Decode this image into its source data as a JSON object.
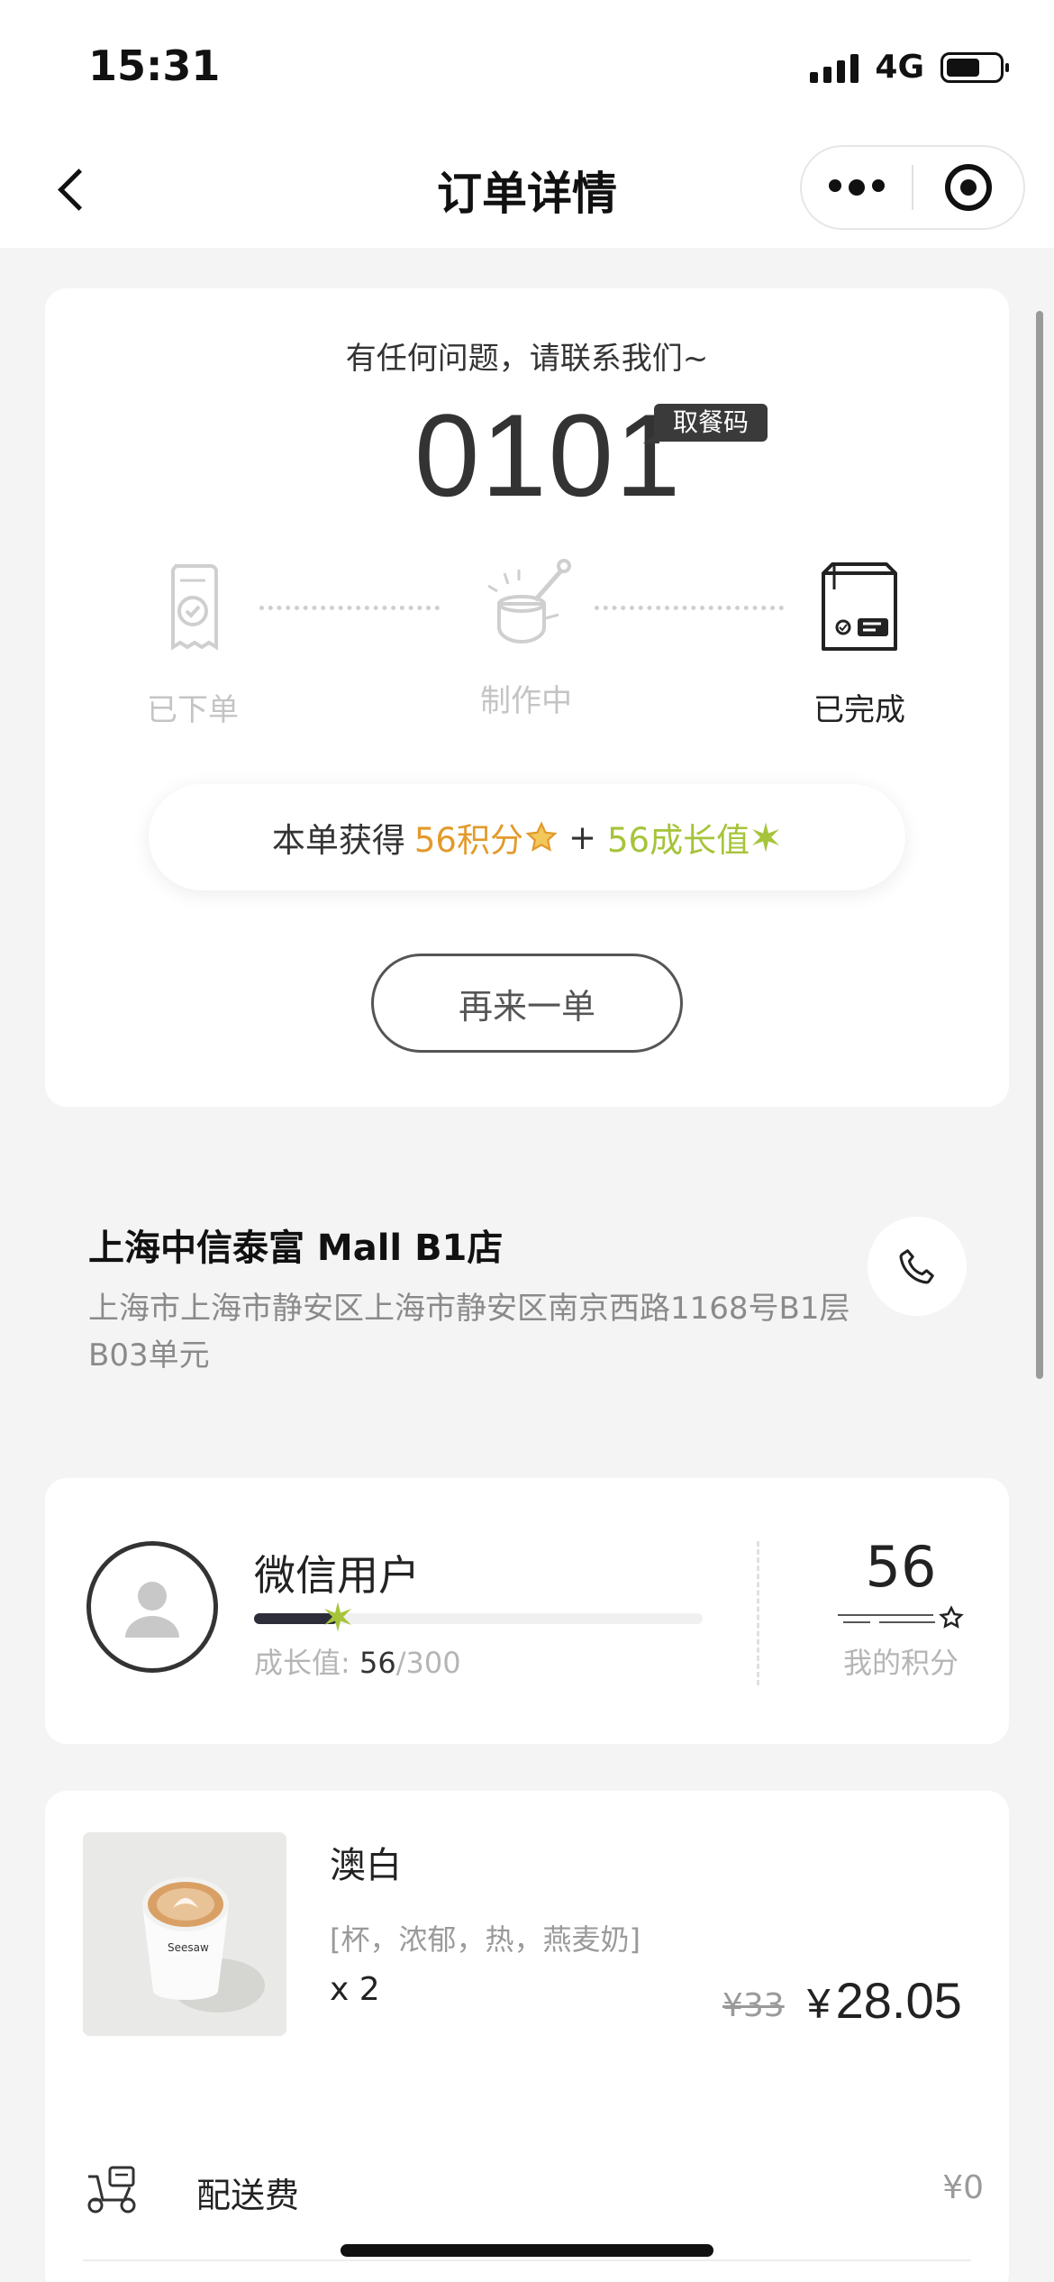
{
  "status_bar": {
    "time": "15:31",
    "network": "4G"
  },
  "nav": {
    "title": "订单详情"
  },
  "order": {
    "contact_text": "有任何问题，请联系我们~",
    "pickup_code": "0101",
    "pickup_badge": "取餐码",
    "steps": [
      {
        "label": "已下单",
        "state": "inactive"
      },
      {
        "label": "制作中",
        "state": "inactive"
      },
      {
        "label": "已完成",
        "state": "active"
      }
    ],
    "earn_prefix": "本单获得",
    "earn_points": "56积分",
    "earn_plus": "+",
    "earn_growth": "56成长值",
    "reorder_label": "再来一单"
  },
  "store": {
    "name": "上海中信泰富 Mall B1店",
    "address": "上海市上海市静安区上海市静安区南京西路1168号B1层B03单元"
  },
  "member": {
    "name": "微信用户",
    "growth_label": "成长值:",
    "growth_current": "56",
    "growth_total": "/300",
    "growth_progress": 0.187,
    "points": "56",
    "points_label": "我的积分"
  },
  "item": {
    "name": "澳白",
    "spec": "[杯，浓郁，热，燕麦奶]",
    "qty": "x 2",
    "price_original": "¥33",
    "price_yen": "¥",
    "price_current": "28.05"
  },
  "fee": {
    "label": "配送费",
    "value": "¥0"
  },
  "colors": {
    "points_orange": "#e39a2b",
    "growth_green": "#a6c43a",
    "dark": "#2d2d3a"
  },
  "icons": [
    "back-icon",
    "more-icon",
    "target-icon",
    "receipt-icon",
    "cooking-pot-icon",
    "bag-icon",
    "star-icon",
    "sparkle-icon",
    "phone-icon",
    "user-avatar-icon",
    "scooter-icon"
  ]
}
